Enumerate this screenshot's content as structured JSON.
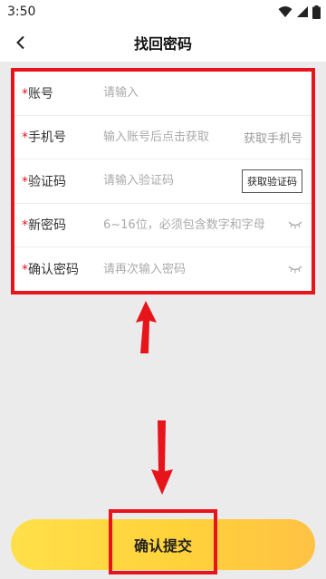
{
  "status_bar": {
    "time": "3:50"
  },
  "nav": {
    "title": "找回密码",
    "back_icon": "chevron-left-icon"
  },
  "form": {
    "account": {
      "required_mark": "*",
      "label": "账号",
      "placeholder": "请输入"
    },
    "phone": {
      "required_mark": "*",
      "label": "手机号",
      "placeholder": "输入账号后点击获取",
      "action": "获取手机号"
    },
    "code": {
      "required_mark": "*",
      "label": "验证码",
      "placeholder": "请输入验证码",
      "action": "获取验证码"
    },
    "new_password": {
      "required_mark": "*",
      "label": "新密码",
      "placeholder": "6~16位，必须包含数字和字母"
    },
    "confirm_password": {
      "required_mark": "*",
      "label": "确认密码",
      "placeholder": "请再次输入密码"
    }
  },
  "submit": {
    "label": "确认提交"
  },
  "colors": {
    "annotation": "#e8141c",
    "button_start": "#ffe04a",
    "button_end": "#ffc244"
  }
}
